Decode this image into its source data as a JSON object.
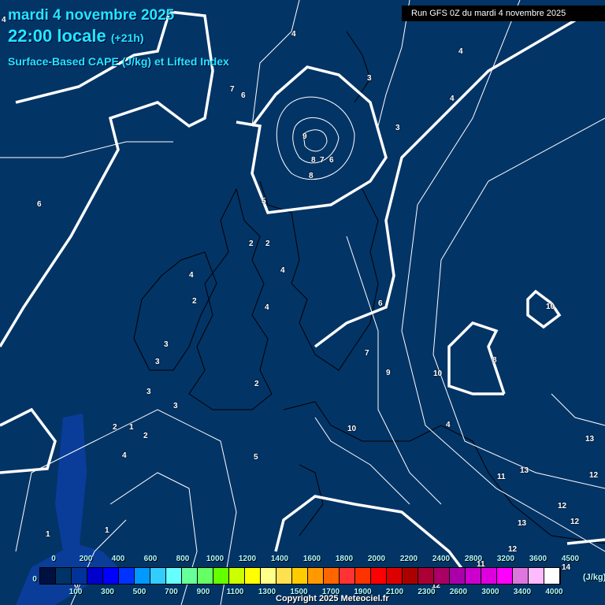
{
  "header": {
    "date": "mardi 4 novembre 2025",
    "time": "22:00 locale",
    "offset": "(+21h)",
    "title": "Surface-Based CAPE (J/kg) et Lifted Index",
    "run": "Run GFS 0Z du mardi 4 novembre 2025"
  },
  "contour_labels": [
    "4",
    "4",
    "4",
    "3",
    "4",
    "3",
    "7",
    "6",
    "9",
    "8",
    "7",
    "6",
    "8",
    "6",
    "5",
    "2",
    "2",
    "4",
    "4",
    "2",
    "4",
    "3",
    "3",
    "3",
    "3",
    "2",
    "2",
    "1",
    "2",
    "4",
    "5",
    "6",
    "7",
    "9",
    "10",
    "10",
    "8",
    "4",
    "10",
    "11",
    "13",
    "13",
    "12",
    "12",
    "13",
    "12",
    "12",
    "11",
    "12",
    "14",
    "1",
    "1",
    "0"
  ],
  "legend": {
    "zero": "0",
    "top_labels": [
      "0",
      "200",
      "400",
      "600",
      "800",
      "1000",
      "1200",
      "1400",
      "1600",
      "1800",
      "2000",
      "2200",
      "2400",
      "2800",
      "3200",
      "3600",
      "4500"
    ],
    "bottom_labels": [
      "100",
      "300",
      "500",
      "700",
      "900",
      "1100",
      "1300",
      "1500",
      "1700",
      "1900",
      "2100",
      "2300",
      "2600",
      "3000",
      "3400",
      "4000"
    ],
    "unit": "(J/kg)",
    "colors": [
      "#001040",
      "#003366",
      "#003399",
      "#0000cc",
      "#0000ff",
      "#0033ff",
      "#0099ff",
      "#33ccff",
      "#66ffff",
      "#66ff99",
      "#66ff66",
      "#66ff00",
      "#ccff00",
      "#ffff00",
      "#ffff88",
      "#ffe050",
      "#ffcc00",
      "#ff9900",
      "#ff6600",
      "#ff3333",
      "#ff3300",
      "#ff0000",
      "#dd0000",
      "#aa0000",
      "#aa0033",
      "#aa0066",
      "#aa00aa",
      "#cc00cc",
      "#dd00dd",
      "#ff00ff",
      "#dd77dd",
      "#ffbbff",
      "#ffffff"
    ]
  },
  "copyright": "Copyright 2025 Meteociel.fr"
}
